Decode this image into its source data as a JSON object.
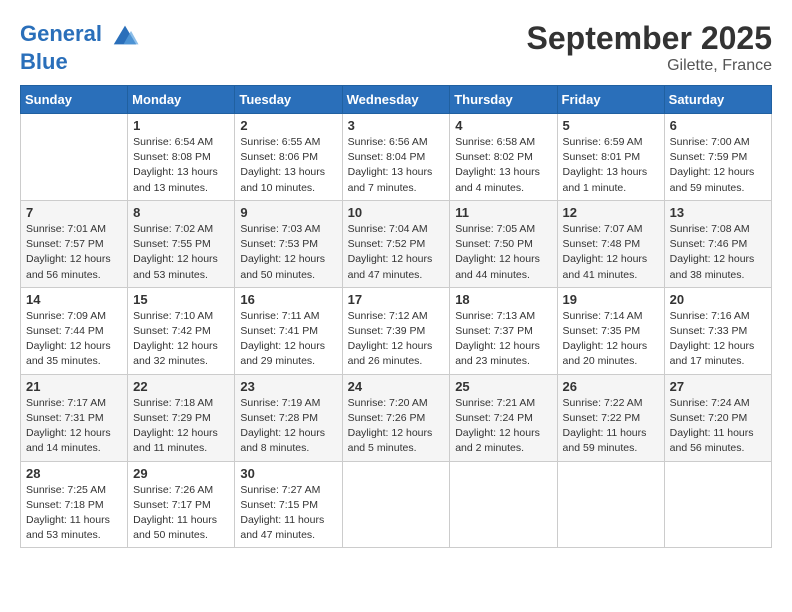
{
  "header": {
    "logo_line1": "General",
    "logo_line2": "Blue",
    "month_title": "September 2025",
    "location": "Gilette, France"
  },
  "days_of_week": [
    "Sunday",
    "Monday",
    "Tuesday",
    "Wednesday",
    "Thursday",
    "Friday",
    "Saturday"
  ],
  "weeks": [
    [
      {
        "day": "",
        "info": ""
      },
      {
        "day": "1",
        "info": "Sunrise: 6:54 AM\nSunset: 8:08 PM\nDaylight: 13 hours\nand 13 minutes."
      },
      {
        "day": "2",
        "info": "Sunrise: 6:55 AM\nSunset: 8:06 PM\nDaylight: 13 hours\nand 10 minutes."
      },
      {
        "day": "3",
        "info": "Sunrise: 6:56 AM\nSunset: 8:04 PM\nDaylight: 13 hours\nand 7 minutes."
      },
      {
        "day": "4",
        "info": "Sunrise: 6:58 AM\nSunset: 8:02 PM\nDaylight: 13 hours\nand 4 minutes."
      },
      {
        "day": "5",
        "info": "Sunrise: 6:59 AM\nSunset: 8:01 PM\nDaylight: 13 hours\nand 1 minute."
      },
      {
        "day": "6",
        "info": "Sunrise: 7:00 AM\nSunset: 7:59 PM\nDaylight: 12 hours\nand 59 minutes."
      }
    ],
    [
      {
        "day": "7",
        "info": "Sunrise: 7:01 AM\nSunset: 7:57 PM\nDaylight: 12 hours\nand 56 minutes."
      },
      {
        "day": "8",
        "info": "Sunrise: 7:02 AM\nSunset: 7:55 PM\nDaylight: 12 hours\nand 53 minutes."
      },
      {
        "day": "9",
        "info": "Sunrise: 7:03 AM\nSunset: 7:53 PM\nDaylight: 12 hours\nand 50 minutes."
      },
      {
        "day": "10",
        "info": "Sunrise: 7:04 AM\nSunset: 7:52 PM\nDaylight: 12 hours\nand 47 minutes."
      },
      {
        "day": "11",
        "info": "Sunrise: 7:05 AM\nSunset: 7:50 PM\nDaylight: 12 hours\nand 44 minutes."
      },
      {
        "day": "12",
        "info": "Sunrise: 7:07 AM\nSunset: 7:48 PM\nDaylight: 12 hours\nand 41 minutes."
      },
      {
        "day": "13",
        "info": "Sunrise: 7:08 AM\nSunset: 7:46 PM\nDaylight: 12 hours\nand 38 minutes."
      }
    ],
    [
      {
        "day": "14",
        "info": "Sunrise: 7:09 AM\nSunset: 7:44 PM\nDaylight: 12 hours\nand 35 minutes."
      },
      {
        "day": "15",
        "info": "Sunrise: 7:10 AM\nSunset: 7:42 PM\nDaylight: 12 hours\nand 32 minutes."
      },
      {
        "day": "16",
        "info": "Sunrise: 7:11 AM\nSunset: 7:41 PM\nDaylight: 12 hours\nand 29 minutes."
      },
      {
        "day": "17",
        "info": "Sunrise: 7:12 AM\nSunset: 7:39 PM\nDaylight: 12 hours\nand 26 minutes."
      },
      {
        "day": "18",
        "info": "Sunrise: 7:13 AM\nSunset: 7:37 PM\nDaylight: 12 hours\nand 23 minutes."
      },
      {
        "day": "19",
        "info": "Sunrise: 7:14 AM\nSunset: 7:35 PM\nDaylight: 12 hours\nand 20 minutes."
      },
      {
        "day": "20",
        "info": "Sunrise: 7:16 AM\nSunset: 7:33 PM\nDaylight: 12 hours\nand 17 minutes."
      }
    ],
    [
      {
        "day": "21",
        "info": "Sunrise: 7:17 AM\nSunset: 7:31 PM\nDaylight: 12 hours\nand 14 minutes."
      },
      {
        "day": "22",
        "info": "Sunrise: 7:18 AM\nSunset: 7:29 PM\nDaylight: 12 hours\nand 11 minutes."
      },
      {
        "day": "23",
        "info": "Sunrise: 7:19 AM\nSunset: 7:28 PM\nDaylight: 12 hours\nand 8 minutes."
      },
      {
        "day": "24",
        "info": "Sunrise: 7:20 AM\nSunset: 7:26 PM\nDaylight: 12 hours\nand 5 minutes."
      },
      {
        "day": "25",
        "info": "Sunrise: 7:21 AM\nSunset: 7:24 PM\nDaylight: 12 hours\nand 2 minutes."
      },
      {
        "day": "26",
        "info": "Sunrise: 7:22 AM\nSunset: 7:22 PM\nDaylight: 11 hours\nand 59 minutes."
      },
      {
        "day": "27",
        "info": "Sunrise: 7:24 AM\nSunset: 7:20 PM\nDaylight: 11 hours\nand 56 minutes."
      }
    ],
    [
      {
        "day": "28",
        "info": "Sunrise: 7:25 AM\nSunset: 7:18 PM\nDaylight: 11 hours\nand 53 minutes."
      },
      {
        "day": "29",
        "info": "Sunrise: 7:26 AM\nSunset: 7:17 PM\nDaylight: 11 hours\nand 50 minutes."
      },
      {
        "day": "30",
        "info": "Sunrise: 7:27 AM\nSunset: 7:15 PM\nDaylight: 11 hours\nand 47 minutes."
      },
      {
        "day": "",
        "info": ""
      },
      {
        "day": "",
        "info": ""
      },
      {
        "day": "",
        "info": ""
      },
      {
        "day": "",
        "info": ""
      }
    ]
  ]
}
